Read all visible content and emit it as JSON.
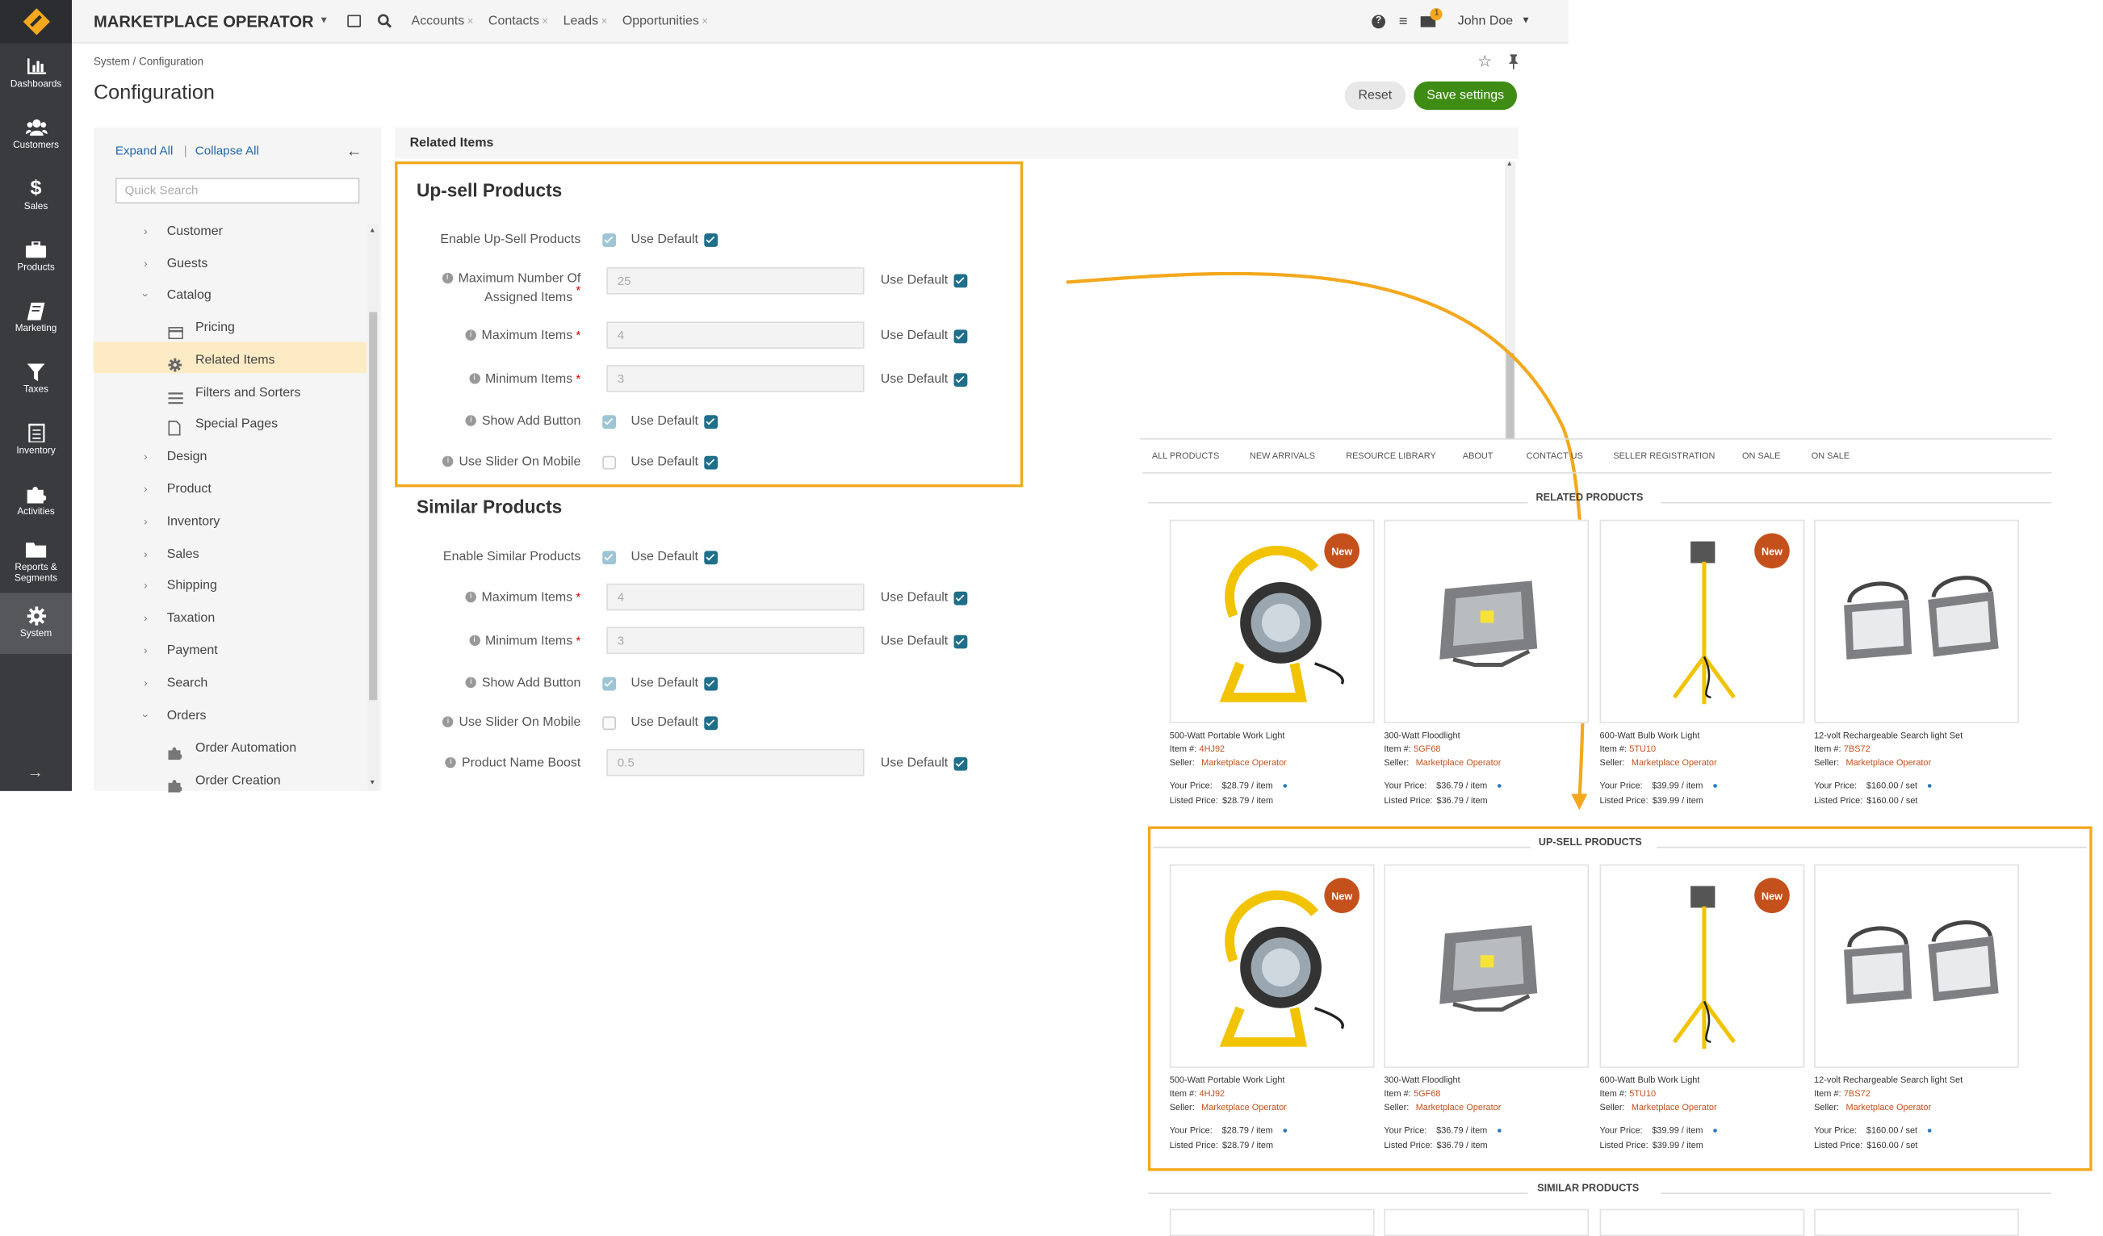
{
  "topbar": {
    "brand": "MARKETPLACE OPERATOR",
    "tabs": [
      {
        "label": "Accounts"
      },
      {
        "label": "Contacts"
      },
      {
        "label": "Leads"
      },
      {
        "label": "Opportunities"
      }
    ],
    "tab_close": "×",
    "user": "John Doe",
    "notification_count": "1"
  },
  "sidenav": {
    "items": [
      {
        "label": "Dashboards",
        "icon": "bar-chart-icon"
      },
      {
        "label": "Customers",
        "icon": "users-icon"
      },
      {
        "label": "Sales",
        "icon": "dollar-icon"
      },
      {
        "label": "Products",
        "icon": "briefcase-icon"
      },
      {
        "label": "Marketing",
        "icon": "book-icon"
      },
      {
        "label": "Taxes",
        "icon": "filter-icon"
      },
      {
        "label": "Inventory",
        "icon": "clipboard-icon"
      },
      {
        "label": "Activities",
        "icon": "puzzle-icon"
      },
      {
        "label": "Reports &",
        "label2": "Segments",
        "icon": "folder-icon"
      },
      {
        "label": "System",
        "icon": "gear-icon",
        "active": true
      }
    ]
  },
  "page": {
    "breadcrumb": "System / Configuration",
    "title": "Configuration",
    "reset_label": "Reset",
    "save_label": "Save settings"
  },
  "tree": {
    "expand_all": "Expand All",
    "collapse_all": "Collapse All",
    "search_placeholder": "Quick Search",
    "items": [
      {
        "label": "Customer"
      },
      {
        "label": "Guests"
      },
      {
        "label": "Catalog"
      },
      {
        "label": "Pricing"
      },
      {
        "label": "Related Items"
      },
      {
        "label": "Filters and Sorters"
      },
      {
        "label": "Special Pages"
      },
      {
        "label": "Design"
      },
      {
        "label": "Product"
      },
      {
        "label": "Inventory"
      },
      {
        "label": "Sales"
      },
      {
        "label": "Shipping"
      },
      {
        "label": "Taxation"
      },
      {
        "label": "Payment"
      },
      {
        "label": "Search"
      },
      {
        "label": "Orders"
      },
      {
        "label": "Order Automation"
      },
      {
        "label": "Order Creation"
      }
    ]
  },
  "form": {
    "section": "Related Items",
    "use_default": "Use Default",
    "upsell": {
      "title": "Up-sell Products",
      "enable": "Enable Up-Sell Products",
      "max_assigned_1": "Maximum Number Of",
      "max_assigned_2": "Assigned Items",
      "max_assigned_value": "25",
      "max_items": "Maximum Items",
      "max_items_value": "4",
      "min_items": "Minimum Items",
      "min_items_value": "3",
      "show_add": "Show Add Button",
      "slider": "Use Slider On Mobile"
    },
    "similar": {
      "title": "Similar Products",
      "enable": "Enable Similar Products",
      "max_items": "Maximum Items",
      "max_items_value": "4",
      "min_items": "Minimum Items",
      "min_items_value": "3",
      "show_add": "Show Add Button",
      "slider": "Use Slider On Mobile",
      "boost": "Product Name Boost",
      "boost_value": "0.5"
    }
  },
  "storefront": {
    "nav": [
      "ALL PRODUCTS",
      "NEW ARRIVALS",
      "RESOURCE LIBRARY",
      "ABOUT",
      "CONTACT US",
      "SELLER REGISTRATION",
      "ON SALE",
      "ON SALE"
    ],
    "related_title": "RELATED PRODUCTS",
    "upsell_title": "UP-SELL PRODUCTS",
    "similar_title": "SIMILAR PRODUCTS",
    "new_badge": "New",
    "item_label": "Item #:",
    "seller_label": "Seller:",
    "your_price_label": "Your Price:",
    "listed_price_label": "Listed Price:",
    "products": [
      {
        "name": "500-Watt Portable Work Light",
        "sku": "4HJ92",
        "seller": "Marketplace Operator",
        "your_price": "$28.79 / item",
        "listed_price": "$28.79 / item",
        "new": true
      },
      {
        "name": "300-Watt Floodlight",
        "sku": "5GF68",
        "seller": "Marketplace Operator",
        "your_price": "$36.79 / item",
        "listed_price": "$36.79 / item",
        "new": false
      },
      {
        "name": "600-Watt Bulb Work Light",
        "sku": "5TU10",
        "seller": "Marketplace Operator",
        "your_price": "$39.99 / item",
        "listed_price": "$39.99 / item",
        "new": true
      },
      {
        "name": "12-volt Rechargeable Search light Set",
        "sku": "7BS72",
        "seller": "Marketplace Operator",
        "your_price": "$160.00 / set",
        "listed_price": "$160.00 / set",
        "new": false
      }
    ]
  },
  "colors": {
    "accent": "#f3a81d",
    "save": "#3f8c14",
    "nav_bg": "#3a3b3f",
    "badge": "#c4501c",
    "checkbox": "#1f6f8b"
  }
}
